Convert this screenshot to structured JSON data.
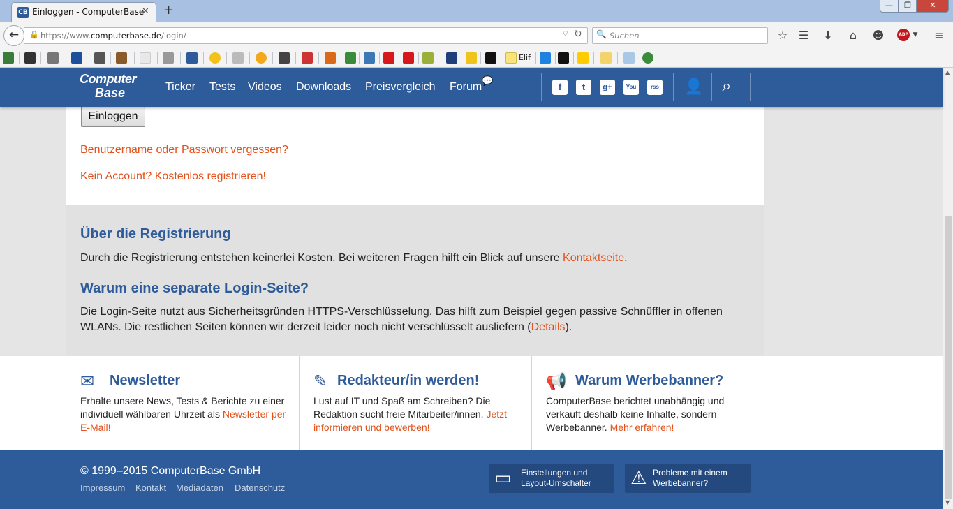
{
  "browser": {
    "tab_title": "Einloggen - ComputerBase",
    "tab_favicon": "CB",
    "tab_close": "✕",
    "new_tab": "+",
    "window_min": "—",
    "window_max": "❐",
    "window_close": "✕",
    "back": "←",
    "url_prefix": "https://www.",
    "url_host": "computerbase.de",
    "url_path": "/login/",
    "search_placeholder": "Suchen",
    "abp_label": "ABP",
    "bookmark_elif_label": "Elif"
  },
  "site": {
    "logo_top": "Computer",
    "logo_bottom": "Base",
    "nav": [
      "Ticker",
      "Tests",
      "Videos",
      "Downloads",
      "Preisvergleich",
      "Forum"
    ],
    "social": [
      "f",
      "t",
      "g+",
      "You",
      "rss"
    ]
  },
  "login": {
    "button": "Einloggen",
    "forgot_link": "Benutzername oder Passwort vergessen?",
    "register_link": "Kein Account? Kostenlos registrieren!"
  },
  "info": {
    "reg_heading": "Über die Registrierung",
    "reg_text_before": "Durch die Registrierung entstehen keinerlei Kosten. Bei weiteren Fragen hilft ein Blick auf unsere ",
    "reg_link": "Kontaktseite",
    "reg_text_after": ".",
    "login_heading": "Warum eine separate Login-Seite?",
    "login_text_before": "Die Login-Seite nutzt aus Sicherheitsgründen HTTPS-Verschlüsselung. Das hilft zum Beispiel gegen passive Schnüffler in offenen WLANs. Die restlichen Seiten können wir derzeit leider noch nicht verschlüsselt ausliefern (",
    "login_link": "Details",
    "login_text_after": ")."
  },
  "promo": [
    {
      "heading": "Newsletter",
      "text": "Erhalte unsere News, Tests & Berichte zu einer individuell wählbaren Uhrzeit als ",
      "link": "Newsletter per E-Mail!"
    },
    {
      "heading": "Redakteur/in werden!",
      "text": "Lust auf IT und Spaß am Schreiben? Die Redaktion sucht freie Mitarbeiter/innen. ",
      "link": "Jetzt informieren und bewerben!"
    },
    {
      "heading": "Warum Werbebanner?",
      "text": "ComputerBase berichtet unabhängig und verkauft deshalb keine Inhalte, sondern Werbebanner. ",
      "link": "Mehr erfahren!"
    }
  ],
  "footer": {
    "copyright": "© 1999–2015 ComputerBase GmbH",
    "links": [
      "Impressum",
      "Kontakt",
      "Mediadaten",
      "Datenschutz"
    ],
    "settings_btn_line1": "Einstellungen und",
    "settings_btn_line2": "Layout-Umschalter",
    "ad_btn_line1": "Probleme mit einem",
    "ad_btn_line2": "Werbebanner?"
  },
  "colors": {
    "brand_blue": "#2e5b9a",
    "link_orange": "#e3501a"
  }
}
